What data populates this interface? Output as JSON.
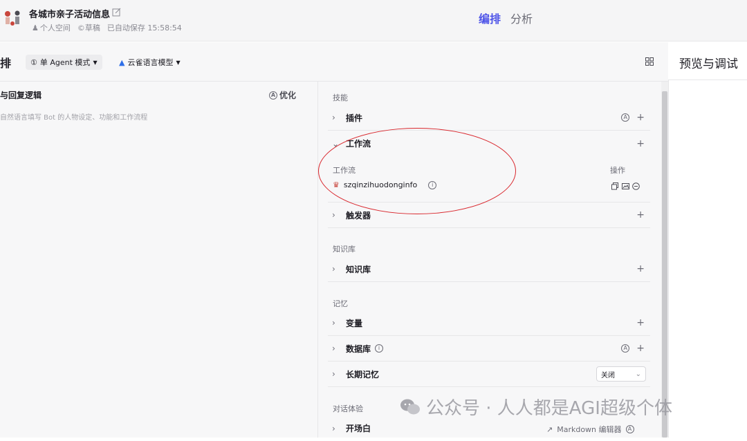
{
  "header": {
    "bot_title": "各城市亲子活动信息",
    "space": "个人空间",
    "draft": "©草稿",
    "autosave": "已自动保存 15:58:54",
    "tabs": [
      "编排",
      "分析"
    ]
  },
  "toolbar": {
    "edge_text": "排",
    "mode_label": "单 Agent 模式",
    "model_label": "云雀语言模型",
    "preview_title": "预览与调试"
  },
  "prompt": {
    "title": "与回复逻辑",
    "optimize_label": "优化",
    "placeholder": "自然语言填写 Bot 的人物设定、功能和工作流程"
  },
  "skills": {
    "section": "技能",
    "plugin": "插件",
    "workflow": "工作流",
    "workflow_col": "工作流",
    "ops_col": "操作",
    "workflow_item": "szqinzihuodonginfo",
    "trigger": "触发器"
  },
  "knowledge": {
    "section": "知识库",
    "item": "知识库"
  },
  "memory": {
    "section": "记忆",
    "variable": "变量",
    "database": "数据库",
    "longterm": "长期记忆",
    "longterm_value": "关闭"
  },
  "dialog": {
    "section": "对话体验",
    "opening": "开场白",
    "markdown_editor": "Markdown 编辑器"
  },
  "watermark": "公众号 · 人人都是AGI超级个体",
  "colors": {
    "accent": "#4d53e8",
    "annotation_red": "#d9262c"
  }
}
